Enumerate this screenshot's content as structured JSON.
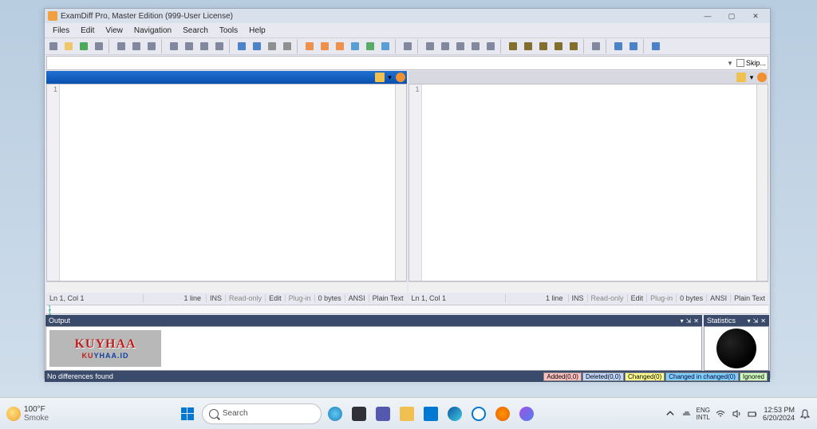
{
  "window": {
    "title": "ExamDiff Pro, Master Edition (999-User License)"
  },
  "menu": [
    "Files",
    "Edit",
    "View",
    "Navigation",
    "Search",
    "Tools",
    "Help"
  ],
  "skip_label": "Skip...",
  "panes": {
    "left": {
      "line_number": "1",
      "status": {
        "pos": "Ln 1, Col 1",
        "lines": "1 line",
        "ins": "INS",
        "ro": "Read-only",
        "edit": "Edit",
        "plugin": "Plug-in",
        "size": "0 bytes",
        "enc": "ANSI",
        "type": "Plain Text"
      }
    },
    "right": {
      "line_number": "1",
      "status": {
        "pos": "Ln 1, Col 1",
        "lines": "1 line",
        "ins": "INS",
        "ro": "Read-only",
        "edit": "Edit",
        "plugin": "Plug-in",
        "size": "0 bytes",
        "enc": "ANSI",
        "type": "Plain Text"
      }
    }
  },
  "ruler": {
    "mark1": "1",
    "mark2": "1"
  },
  "output": {
    "title": "Output"
  },
  "stats": {
    "title": "Statistics"
  },
  "watermark": {
    "top": "KUYHAA",
    "bot_red": "KU",
    "bot_blue": "YHAA.ID"
  },
  "bottom": {
    "msg": "No differences found"
  },
  "diff_badges": {
    "added": "Added(0,0)",
    "deleted": "Deleted(0,0)",
    "changed": "Changed(0)",
    "cic": "Changed in changed(0)",
    "ignored": "Ignored"
  },
  "taskbar": {
    "weather": {
      "temp": "100°F",
      "cond": "Smoke"
    },
    "search_placeholder": "Search",
    "lang": {
      "top": "ENG",
      "bot": "INTL"
    },
    "clock": {
      "time": "12:53 PM",
      "date": "6/20/2024"
    }
  },
  "toolbar_icons": [
    "new-compare",
    "open",
    "save",
    "save-all",
    "|",
    "save-left",
    "save-right",
    "print",
    "|",
    "cut",
    "copy",
    "paste",
    "find",
    "|",
    "undo",
    "redo",
    "prev",
    "next",
    "|",
    "view-side",
    "view-left",
    "view-right",
    "view-both",
    "view-over",
    "all-diffs",
    "|",
    "swap",
    "|",
    "sync-scroll",
    "align-left",
    "align-right",
    "align-center",
    "lock",
    "|",
    "first-diff",
    "prev-diff",
    "next-diff",
    "last-diff",
    "curr-diff",
    "|",
    "bookmark",
    "|",
    "plugins",
    "options",
    "|",
    "help"
  ]
}
